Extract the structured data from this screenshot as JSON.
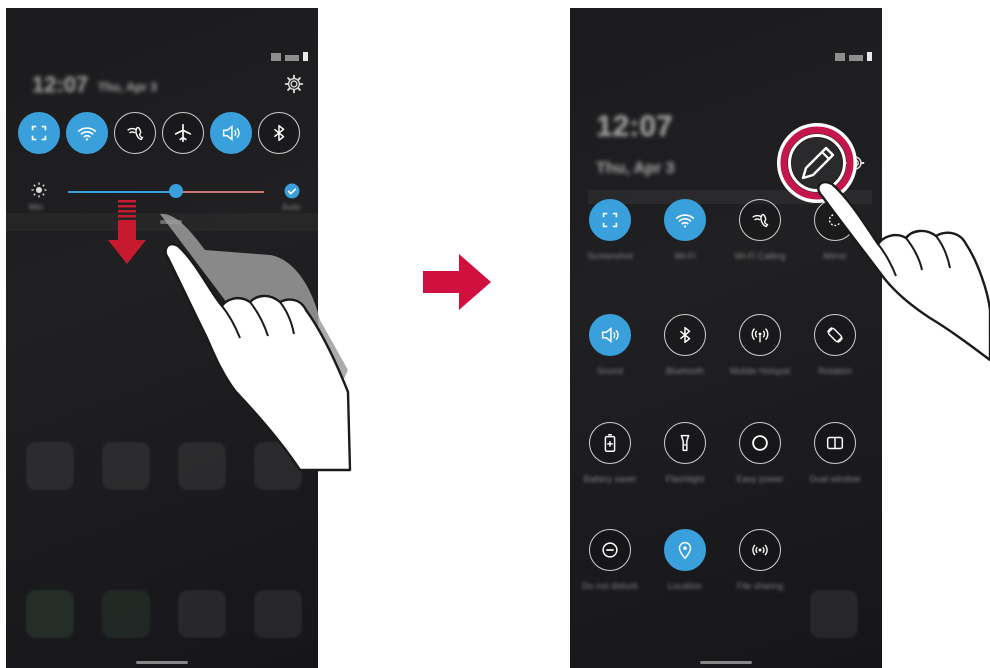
{
  "left_screen": {
    "time": "12:07",
    "date": "Thu, Apr 3",
    "quick_tiles": [
      {
        "id": "capture",
        "active": true
      },
      {
        "id": "wifi",
        "active": true
      },
      {
        "id": "wifi-calling",
        "active": false
      },
      {
        "id": "airplane",
        "active": false
      },
      {
        "id": "sound",
        "active": true
      },
      {
        "id": "bluetooth",
        "active": false
      }
    ],
    "brightness_level": 0.55,
    "brightness_label": "Min",
    "auto_label": "Auto"
  },
  "right_screen": {
    "time": "12:07",
    "date": "Thu, Apr 3",
    "tiles": [
      {
        "id": "capture",
        "label": "Screenshot",
        "active": true
      },
      {
        "id": "wifi",
        "label": "Wi-Fi",
        "active": true
      },
      {
        "id": "wifi-calling",
        "label": "Wi-Fi Calling",
        "active": false
      },
      {
        "id": "mirror",
        "label": "Mirror",
        "active": false
      },
      {
        "id": "sound",
        "label": "Sound",
        "active": true
      },
      {
        "id": "bluetooth",
        "label": "Bluetooth",
        "active": false
      },
      {
        "id": "hotspot",
        "label": "Mobile Hotspot",
        "active": false
      },
      {
        "id": "rotation",
        "label": "Rotation",
        "active": false
      },
      {
        "id": "battery",
        "label": "Battery saver",
        "active": false
      },
      {
        "id": "flashlight",
        "label": "Flashlight",
        "active": false
      },
      {
        "id": "easy-power",
        "label": "Easy power",
        "active": false
      },
      {
        "id": "dual-window",
        "label": "Dual window",
        "active": false
      },
      {
        "id": "do-not-disturb",
        "label": "Do not disturb",
        "active": false
      },
      {
        "id": "location",
        "label": "Location",
        "active": true
      },
      {
        "id": "file-sharing",
        "label": "File sharing",
        "active": false
      }
    ]
  },
  "colors": {
    "accent": "#3aa0db",
    "arrow": "#d0103f",
    "pointer_arrow": "#c81a2e",
    "highlight_ring": "#c4164a"
  }
}
